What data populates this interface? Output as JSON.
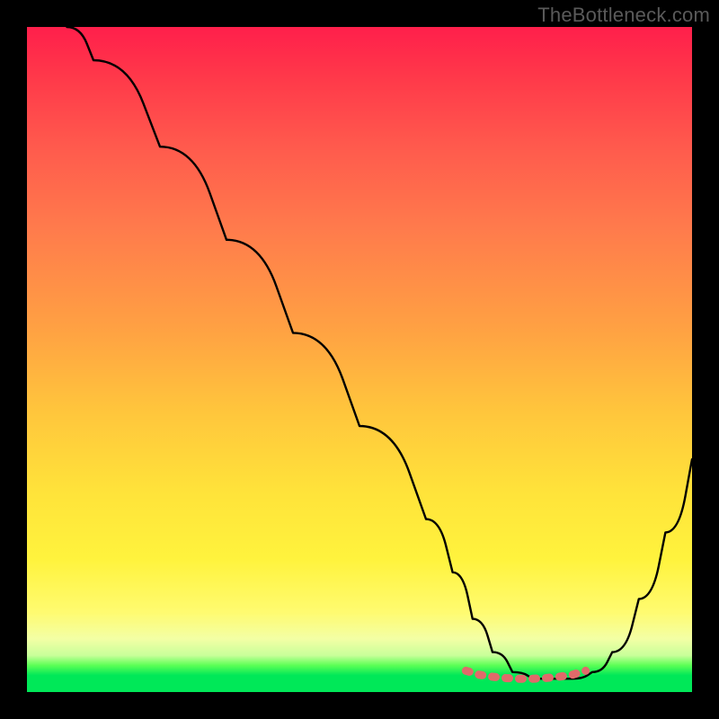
{
  "watermark": "TheBottleneck.com",
  "chart_data": {
    "type": "line",
    "title": "",
    "xlabel": "",
    "ylabel": "",
    "xlim": [
      0,
      100
    ],
    "ylim": [
      0,
      100
    ],
    "grid": false,
    "series": [
      {
        "name": "curve",
        "color": "#000000",
        "x": [
          6,
          10,
          20,
          30,
          40,
          50,
          60,
          64,
          67,
          70,
          73,
          76,
          79,
          82,
          85,
          88,
          92,
          96,
          100
        ],
        "y": [
          100,
          95,
          82,
          68,
          54,
          40,
          26,
          18,
          11,
          6,
          3,
          2,
          2,
          2,
          3,
          6,
          14,
          24,
          35
        ]
      },
      {
        "name": "flat-zone-marker",
        "color": "#e06a6a",
        "x": [
          66,
          68,
          70,
          72,
          74,
          76,
          78,
          80,
          82,
          84
        ],
        "y": [
          3.2,
          2.6,
          2.3,
          2.1,
          2.0,
          2.0,
          2.1,
          2.3,
          2.6,
          3.2
        ]
      }
    ],
    "background_gradient": {
      "orientation": "vertical",
      "stops": [
        {
          "pos": 0.0,
          "color": "#ff1f4b"
        },
        {
          "pos": 0.3,
          "color": "#ff7a4c"
        },
        {
          "pos": 0.6,
          "color": "#ffd53a"
        },
        {
          "pos": 0.85,
          "color": "#fffb70"
        },
        {
          "pos": 0.95,
          "color": "#9dff7d"
        },
        {
          "pos": 1.0,
          "color": "#00e858"
        }
      ]
    }
  }
}
